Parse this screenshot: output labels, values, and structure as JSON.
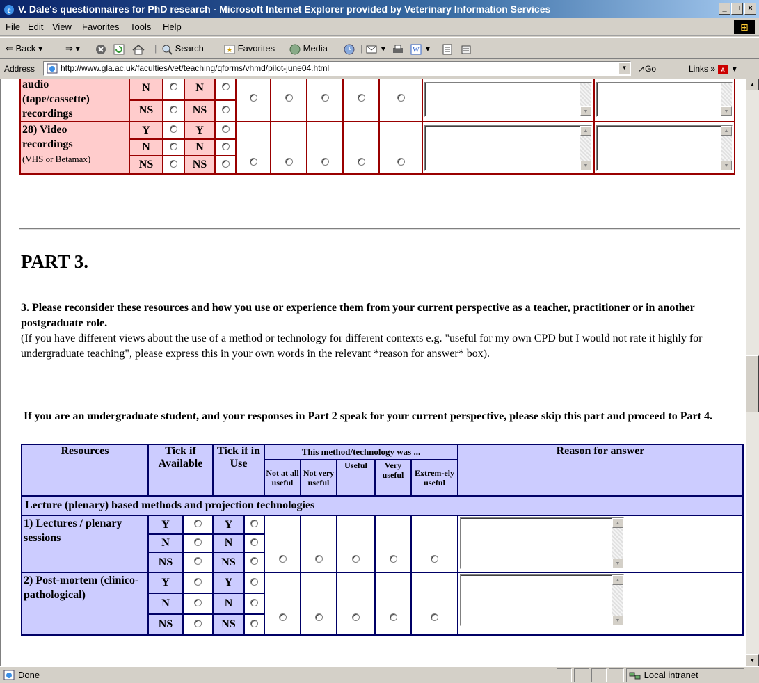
{
  "window": {
    "title": "V. Dale's questionnaires for PhD research - Microsoft Internet Explorer provided by Veterinary Information Services",
    "min": "_",
    "max": "□",
    "close": "×"
  },
  "menu": [
    "File",
    "Edit",
    "View",
    "Favorites",
    "Tools",
    "Help"
  ],
  "toolbar": {
    "back": "Back",
    "search": "Search",
    "favorites": "Favorites",
    "media": "Media"
  },
  "address": {
    "label": "Address",
    "url": "http://www.gla.ac.uk/faculties/vet/teaching/qforms/vhmd/pilot-june04.html",
    "go": "Go",
    "links": "Links"
  },
  "part2_rows": [
    {
      "label_line1": "audio",
      "label_line2": "(tape/cassette)",
      "label_line3": "recordings",
      "avail": [
        "N",
        "NS"
      ],
      "inuse": [
        "N",
        "NS"
      ]
    },
    {
      "label_line1": "28) Video",
      "label_line2": "recordings",
      "label_line3": "(VHS or Betamax)",
      "avail": [
        "Y",
        "N",
        "NS"
      ],
      "inuse": [
        "Y",
        "N",
        "NS"
      ]
    }
  ],
  "part3": {
    "heading": "PART 3.",
    "question_bold": "3. Please reconsider these resources and how you use or experience them from your current perspective as a teacher, practitioner or in another postgraduate role.",
    "question_note": "(If you have different views about the use of a method or technology for different contexts e.g. \"useful for my own CPD but I would not rate it highly for undergraduate teaching\", please express this in your own words in the relevant *reason for answer* box).",
    "skip_note": "If you are an undergraduate student, and your responses in Part 2 speak for your current perspective, please skip this part and proceed to Part 4."
  },
  "table3": {
    "col_resources": "Resources",
    "col_avail": "Tick if Available",
    "col_inuse": "Tick if in Use",
    "col_method": "This method/technology was ...",
    "col_reason": "Reason for answer",
    "ratings": [
      "Not at all useful",
      "Not very useful",
      "Useful",
      "Very useful",
      "Extrem-ely useful"
    ],
    "section": "Lecture (plenary) based methods and projection technologies",
    "rows": [
      {
        "label": "1) Lectures / plenary sessions"
      },
      {
        "label": "2) Post-mortem (clinico-pathological)"
      }
    ],
    "yn": [
      "Y",
      "N",
      "NS"
    ]
  },
  "status": {
    "text": "Done",
    "zone": "Local intranet"
  }
}
